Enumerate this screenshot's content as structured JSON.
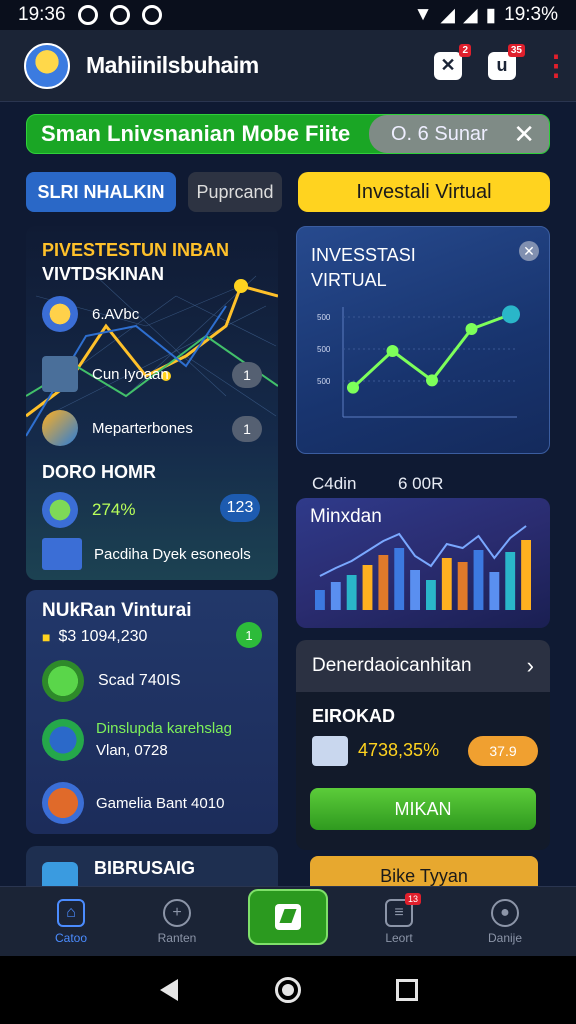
{
  "status": {
    "time": "19:36",
    "battery": "19:3%"
  },
  "appbar": {
    "title": "Mahiinilsbuhaim",
    "badge1": "2",
    "badge2": "35",
    "icon1": "u"
  },
  "banner": {
    "text": "Sman Lnivsnanian Mobe Fiite",
    "right": "O. 6 Sunar"
  },
  "chips": {
    "first": "SLRI NHALKIN",
    "second": "Puprcand",
    "third": "Investali Virtual"
  },
  "card1": {
    "title_line1": "PIVESTESTUN INBAN",
    "title_line2": "VIVTDSKINAN",
    "row1": "6.AVbc",
    "row2": "Cun Iyoaan",
    "row2_pill": "1",
    "row3": "Meparterbones",
    "row3_pill": "1",
    "section": "DORO HOMR",
    "pct": "274%",
    "pct_pill": "123",
    "footer": "Pacdiha Dyek esoneols"
  },
  "card2": {
    "title_line1": "INVESSTASI",
    "title_line2": "VIRTUAL",
    "y_labels": [
      "500",
      "500",
      "500"
    ],
    "points": [
      28,
      38,
      30,
      44,
      48
    ]
  },
  "stats": {
    "left": "C4din",
    "right": "6 00R"
  },
  "card3": {
    "title": "Minxdan",
    "bars": [
      20,
      28,
      35,
      45,
      55,
      62,
      40,
      30,
      52,
      48,
      60,
      38,
      58,
      70
    ]
  },
  "card4": {
    "title": "NUkRan Vinturai",
    "amount": "$3 1094,230",
    "amount_badge": "1",
    "row1": "Scad 740IS",
    "row2a": "Dinslupda karehslag",
    "row2b": "Vlan, 0728",
    "row3": "Gamelia Bant 4010"
  },
  "card5": {
    "header": "Denerdaoicanhitan",
    "label": "EIROKAD",
    "value": "4738,35%",
    "badge": "37.9",
    "button": "MIKAN"
  },
  "card6": {
    "title": "BIBRUSAIG"
  },
  "card7": {
    "label": "Bike Tyyan"
  },
  "nav": {
    "items": [
      {
        "label": "Catoo"
      },
      {
        "label": "Ranten"
      },
      {
        "label": ""
      },
      {
        "label": "Leort"
      },
      {
        "label": "Danije"
      }
    ],
    "badge": "13"
  },
  "colors": {
    "accent_green": "#2b9a1f",
    "accent_yellow": "#ffd31f",
    "accent_blue": "#2a68c7"
  }
}
